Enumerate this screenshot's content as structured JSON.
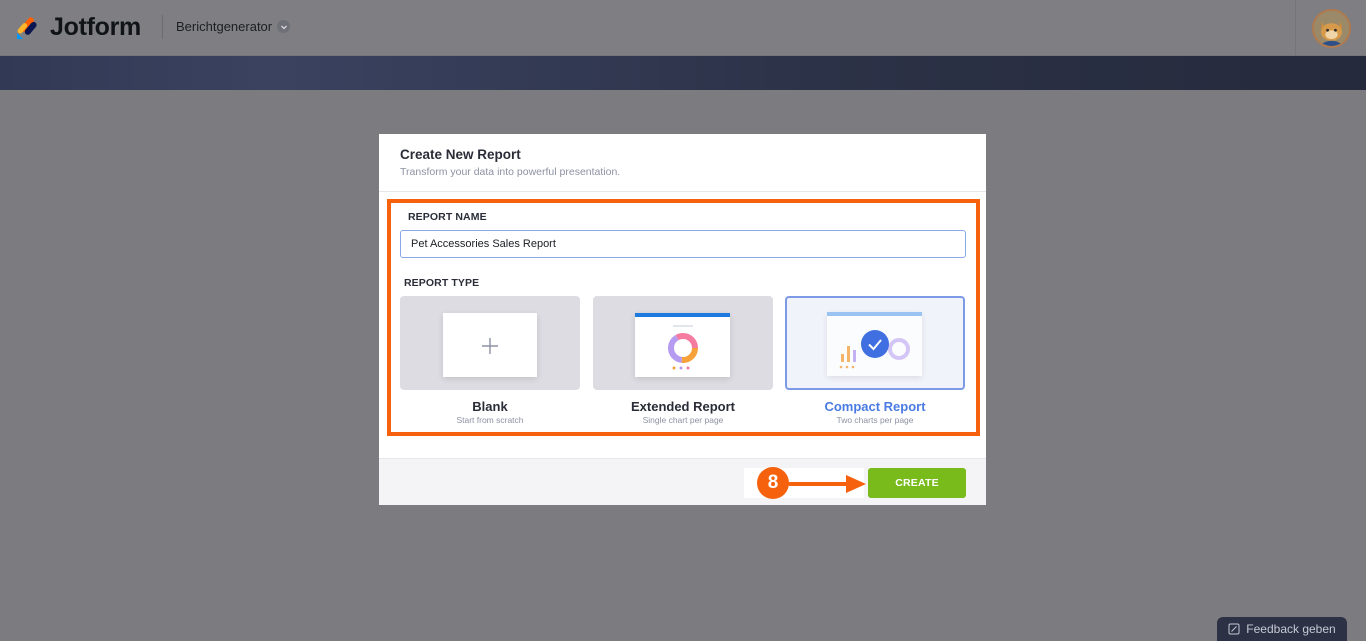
{
  "header": {
    "logo_text": "Jotform",
    "app_name": "Berichtgenerator"
  },
  "modal": {
    "title": "Create New Report",
    "subtitle": "Transform your data into powerful presentation.",
    "name_label": "REPORT NAME",
    "name_value": "Pet Accessories Sales Report",
    "type_label": "REPORT TYPE",
    "types": [
      {
        "title": "Blank",
        "subtitle": "Start from scratch",
        "selected": false
      },
      {
        "title": "Extended Report",
        "subtitle": "Single chart per page",
        "selected": false
      },
      {
        "title": "Compact Report",
        "subtitle": "Two charts per page",
        "selected": true
      }
    ],
    "create_label": "CREATE"
  },
  "annotation": {
    "step_number": "8"
  },
  "feedback": {
    "label": "Feedback geben"
  },
  "colors": {
    "accent_orange": "#f5610d",
    "create_green": "#78bb1b",
    "selected_blue": "#4a7be2"
  }
}
